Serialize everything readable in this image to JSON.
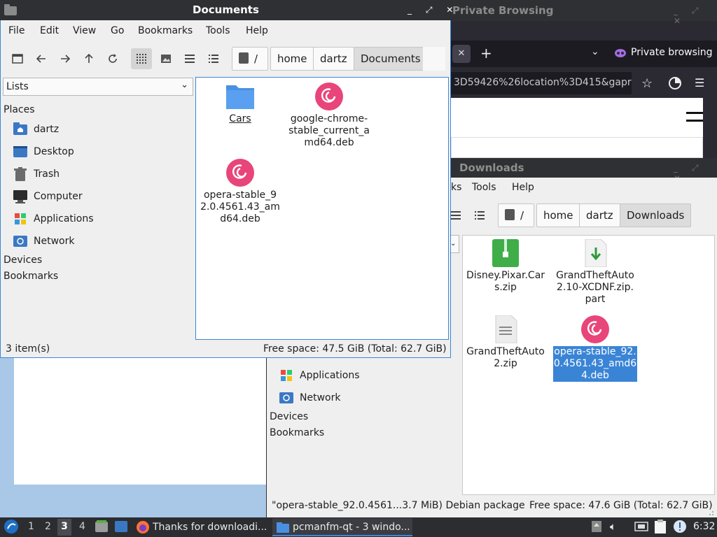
{
  "browser": {
    "title": "Private Browsing",
    "private_label": "Private browsing",
    "url_text": "3D59426%26location%3D415&gapro"
  },
  "documents_window": {
    "title": "Documents",
    "menu": [
      "File",
      "Edit",
      "View",
      "Go",
      "Bookmarks",
      "Tools",
      "Help"
    ],
    "breadcrumb_root": "/",
    "breadcrumbs": [
      "home",
      "dartz",
      "Documents"
    ],
    "side_select": "Lists",
    "places_label": "Places",
    "places": [
      {
        "label": "dartz",
        "icon": "home-folder-icon"
      },
      {
        "label": "Desktop",
        "icon": "desktop-icon"
      },
      {
        "label": "Trash",
        "icon": "trash-icon"
      },
      {
        "label": "Computer",
        "icon": "computer-icon"
      },
      {
        "label": "Applications",
        "icon": "applications-icon"
      },
      {
        "label": "Network",
        "icon": "network-icon"
      }
    ],
    "devices_label": "Devices",
    "bookmarks_label": "Bookmarks",
    "files": [
      {
        "name": "Cars",
        "icon": "folder-icon"
      },
      {
        "name": "google-chrome-stable_current_amd64.deb",
        "icon": "debian-package-icon"
      },
      {
        "name": "opera-stable_92.0.4561.43_amd64.deb",
        "icon": "debian-package-icon"
      }
    ],
    "status_count": "3 item(s)",
    "status_space": "Free space: 47.5 GiB (Total: 62.7 GiB)"
  },
  "downloads_window": {
    "title": "Downloads",
    "menu_partial": "ks",
    "menu": [
      "Tools",
      "Help"
    ],
    "breadcrumb_root": "/",
    "breadcrumbs": [
      "home",
      "dartz",
      "Downloads"
    ],
    "places": [
      {
        "label": "Applications",
        "icon": "applications-icon"
      },
      {
        "label": "Network",
        "icon": "network-icon"
      }
    ],
    "devices_label": "Devices",
    "bookmarks_label": "Bookmarks",
    "files": [
      {
        "name": "Disney.Pixar.Cars.zip",
        "icon": "zip-archive-icon"
      },
      {
        "name": "GrandTheftAuto2.10-XCDNF.zip.part",
        "icon": "partial-download-icon"
      },
      {
        "name": "GrandTheftAuto2.zip",
        "icon": "text-file-icon"
      },
      {
        "name": "opera-stable_92.0.4561.43_amd64.deb",
        "icon": "debian-package-icon",
        "selected": true
      }
    ],
    "status_selection": "\"opera-stable_92.0.4561...3.7 MiB) Debian package",
    "status_space": "Free space: 47.6 GiB (Total: 62.7 GiB)"
  },
  "taskbar": {
    "workspaces": [
      "1",
      "2",
      "3",
      "4"
    ],
    "active_workspace": "3",
    "tasks": [
      {
        "label": "Thanks for downloadi...",
        "icon": "firefox-icon"
      },
      {
        "label": "pcmanfm-qt - 3 windo...",
        "icon": "folder-icon"
      }
    ],
    "clock": "6:32"
  },
  "colors": {
    "selection": "#3a84d6",
    "titlebar": "#2f3033",
    "debian": "#e8457a"
  }
}
